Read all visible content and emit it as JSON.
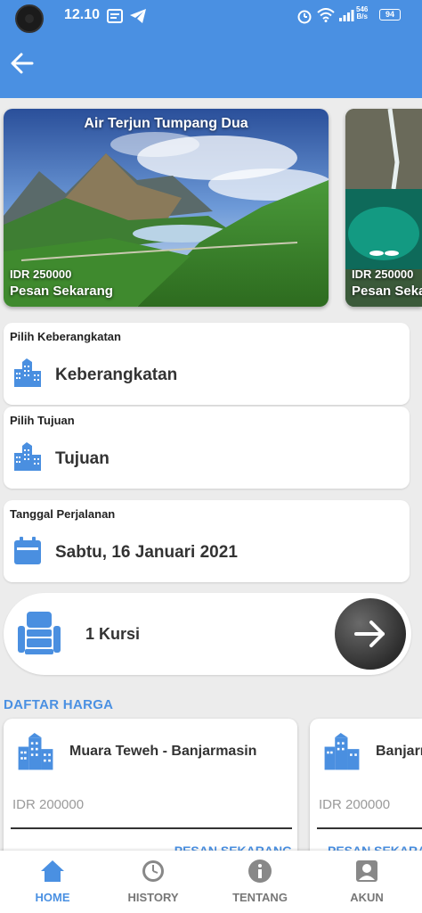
{
  "status_bar": {
    "time": "12.10",
    "net_speed_value": "546",
    "net_speed_unit": "B/s",
    "battery": "94"
  },
  "app_bar": {
    "back_icon": "back-arrow-icon"
  },
  "destinations": [
    {
      "title": "Air Terjun Tumpang Dua",
      "price": "IDR 250000",
      "cta": "Pesan Sekarang"
    },
    {
      "title": "",
      "price": "IDR 250000",
      "cta": "Pesan Sekarang"
    }
  ],
  "form": {
    "departure": {
      "label": "Pilih Keberangkatan",
      "value": "Keberangkatan",
      "icon": "city-icon"
    },
    "destination": {
      "label": "Pilih Tujuan",
      "value": "Tujuan",
      "icon": "city-icon"
    },
    "date": {
      "label": "Tanggal Perjalanan",
      "value": "Sabtu, 16 Januari 2021",
      "icon": "calendar-icon"
    },
    "seats": {
      "value": "1 Kursi",
      "icon": "seat-icon"
    }
  },
  "price_list": {
    "title": "DAFTAR HARGA",
    "items": [
      {
        "route": "Muara Teweh - Banjarmasin",
        "price": "IDR 200000",
        "cta": "PESAN SEKARANG"
      },
      {
        "route": "Banjarmasin",
        "price": "IDR 200000",
        "cta": "PESAN SEKARANG"
      }
    ]
  },
  "bottom_nav": [
    {
      "label": "HOME",
      "icon": "home-icon",
      "active": true
    },
    {
      "label": "HISTORY",
      "icon": "history-clock-icon",
      "active": false
    },
    {
      "label": "TENTANG",
      "icon": "info-icon",
      "active": false
    },
    {
      "label": "AKUN",
      "icon": "account-icon",
      "active": false
    }
  ],
  "colors": {
    "primary": "#4a90e2",
    "background": "#ececec",
    "card": "#ffffff",
    "icon_blue": "#4a8fe0",
    "muted_text": "#9a9a9a"
  }
}
